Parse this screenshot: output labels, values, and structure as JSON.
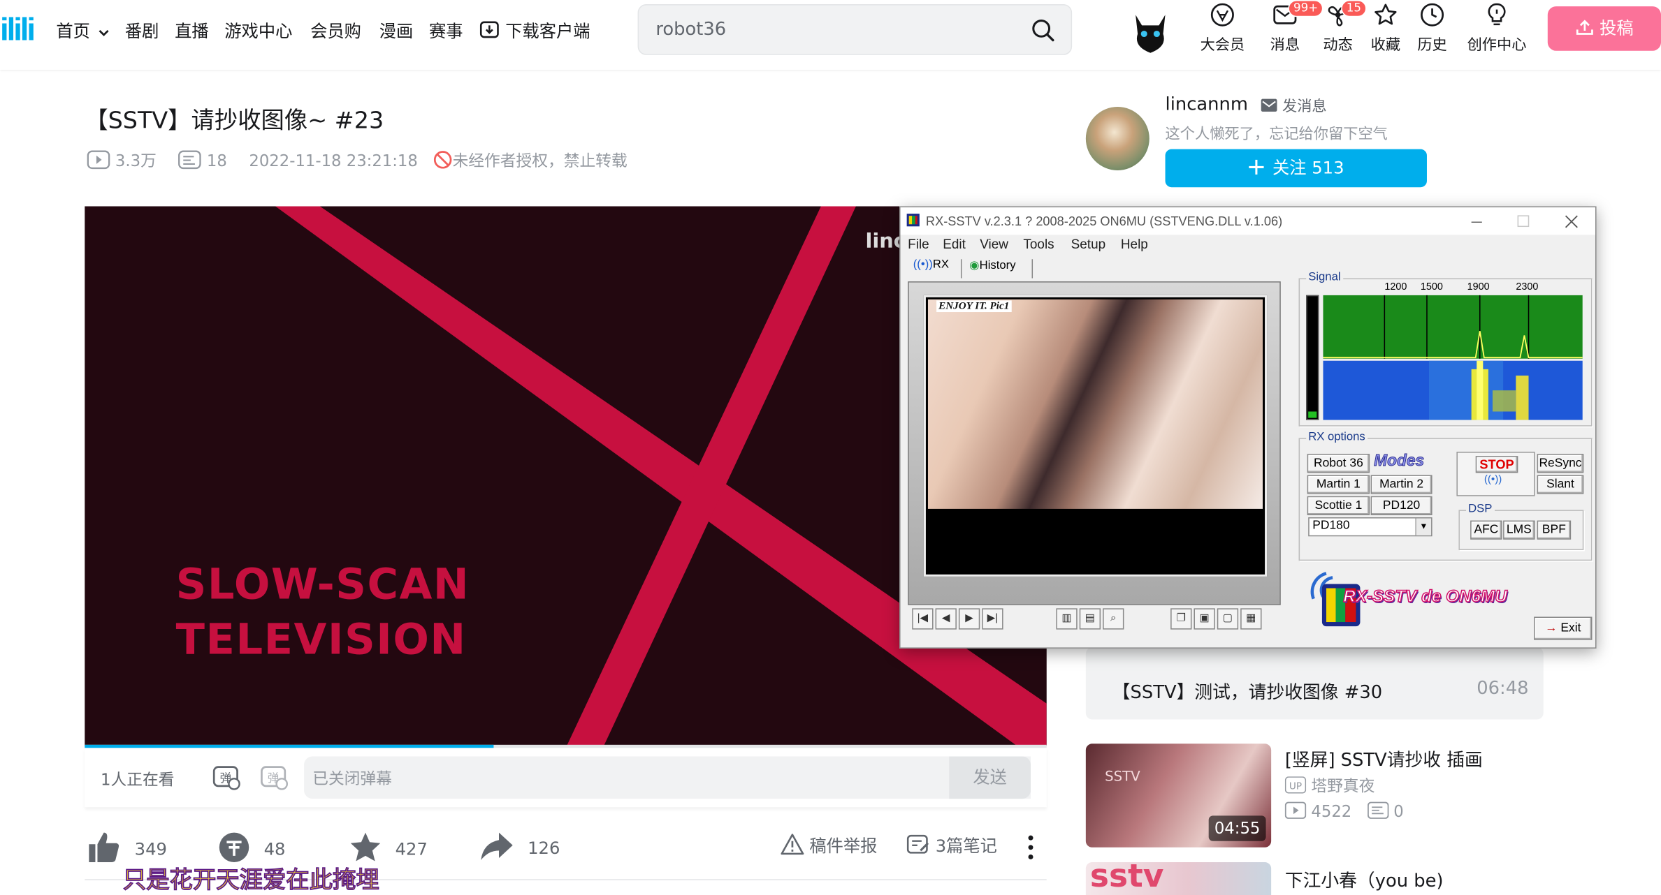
{
  "header": {
    "logo": "ilili",
    "nav": [
      {
        "label": "首页",
        "has_dropdown": true
      },
      {
        "label": "番剧"
      },
      {
        "label": "直播"
      },
      {
        "label": "游戏中心"
      },
      {
        "label": "会员购"
      },
      {
        "label": "漫画"
      },
      {
        "label": "赛事"
      },
      {
        "label": "下载客户端",
        "icon": "download-icon"
      }
    ],
    "search": {
      "value": "robot36",
      "icon": "search-icon"
    },
    "actions": [
      {
        "label": "大会员",
        "icon": "vip-icon"
      },
      {
        "label": "消息",
        "icon": "message-icon",
        "badge": "99+"
      },
      {
        "label": "动态",
        "icon": "dynamic-icon",
        "badge": "15"
      },
      {
        "label": "收藏",
        "icon": "star-icon"
      },
      {
        "label": "历史",
        "icon": "clock-icon"
      },
      {
        "label": "创作中心",
        "icon": "bulb-icon"
      }
    ],
    "upload": {
      "label": "投稿",
      "icon": "upload-icon"
    },
    "colors": {
      "brand": "#00aeec",
      "pink": "#fb7299",
      "badge": "#fa5a57"
    }
  },
  "video": {
    "title": "【SSTV】请抄收图像~ #23",
    "views": "3.3万",
    "danmaku_count": "18",
    "date": "2022-11-18 23:21:18",
    "copyright": "未经作者授权，禁止转载",
    "player": {
      "overlay_line1": "SLOW-SCAN",
      "overlay_line2": "TELEVISION",
      "watermark": "linc",
      "progress": 0.425,
      "colors": {
        "bg": "#230810",
        "stripe": "#c7103f"
      }
    },
    "danmu": {
      "watching": "1人正在看",
      "placeholder": "已关闭弹幕",
      "send": "发送"
    },
    "toolbar": {
      "likes": "349",
      "coins": "48",
      "favorites": "427",
      "shares": "126",
      "report": "稿件举报",
      "notes": "3篇笔记"
    },
    "lyric": "只是花开天涯爱在此掩埋"
  },
  "uploader": {
    "name": "lincannm",
    "message": "发消息",
    "signature": "这个人懒死了，忘记给你留下空气",
    "follow": "关注 513"
  },
  "related": [
    {
      "title": "【SSTV】测试，请抄收图像 #30",
      "duration": "06:48"
    },
    {
      "title": "[竖屏] SSTV请抄收 插画",
      "author": "塔野真夜",
      "views": "4522",
      "danmaku": "0",
      "duration": "04:55",
      "thumb_text": "SSTV"
    },
    {
      "title": "下江小春（you be)",
      "thumb_text": "sstv"
    }
  ],
  "rxsstv": {
    "title": "RX-SSTV v.2.3.1 ? 2008-2025 ON6MU (SSTVENG.DLL v.1.06)",
    "menu": [
      "File",
      "Edit",
      "View",
      "Tools",
      "Setup",
      "Help"
    ],
    "tabs": [
      "RX",
      "History"
    ],
    "image_caption": "ENJOY IT.  Pic1",
    "signal_label": "Signal",
    "signal_ticks": [
      "1200",
      "1500",
      "1900",
      "2300"
    ],
    "options_label": "RX options",
    "modes": [
      "Robot 36",
      "Martin 1",
      "Martin 2",
      "Scottie 1",
      "PD120"
    ],
    "modes_label": "Modes",
    "mode_select": "PD180",
    "stop": "STOP",
    "resync": "ReSync",
    "slant": "Slant",
    "dsp_label": "DSP",
    "dsp": [
      "AFC",
      "LMS",
      "BPF"
    ],
    "brand": "RX-SSTV de ON6MU",
    "exit": "Exit"
  }
}
